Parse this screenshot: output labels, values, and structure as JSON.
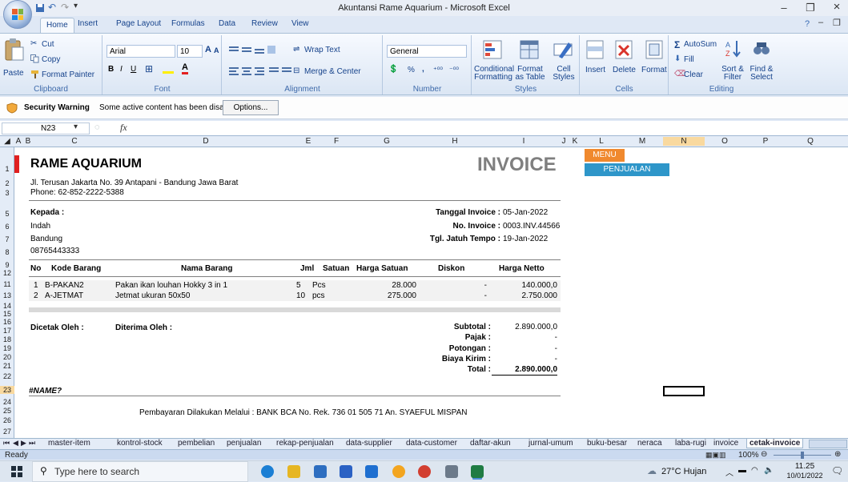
{
  "window": {
    "title": "Akuntansi Rame Aquarium - Microsoft Excel",
    "minimize": "–",
    "maximize": "❐",
    "close": "×"
  },
  "tabs": [
    "Home",
    "Insert",
    "Page Layout",
    "Formulas",
    "Data",
    "Review",
    "View"
  ],
  "ribbon": {
    "clipboard": {
      "paste": "Paste",
      "cut": "Cut",
      "copy": "Copy",
      "format_painter": "Format Painter",
      "label": "Clipboard"
    },
    "font": {
      "name": "Arial",
      "size": "10",
      "label": "Font",
      "bold": "B",
      "italic": "I",
      "underline": "U",
      "grow": "A",
      "shrink": "A"
    },
    "alignment": {
      "wrap": "Wrap Text",
      "merge": "Merge & Center",
      "label": "Alignment"
    },
    "number": {
      "format": "General",
      "percent": "%",
      "comma": ",",
      "label": "Number"
    },
    "styles": {
      "conditional": "Conditional Formatting",
      "format_table": "Format as Table",
      "cell_styles": "Cell Styles",
      "label": "Styles"
    },
    "cells": {
      "insert": "Insert",
      "delete": "Delete",
      "format": "Format",
      "label": "Cells"
    },
    "editing": {
      "autosum": "AutoSum",
      "fill": "Fill",
      "clear": "Clear",
      "sort": "Sort & Filter",
      "find": "Find & Select",
      "label": "Editing"
    }
  },
  "security": {
    "title": "Security Warning",
    "message": "Some active content has been disabled.",
    "button": "Options..."
  },
  "formula_bar": {
    "name_box": "N23",
    "fx": "fx",
    "value": ""
  },
  "columns": [
    "A",
    "B",
    "C",
    "D",
    "E",
    "F",
    "G",
    "H",
    "I",
    "J",
    "K",
    "L",
    "M",
    "N",
    "O",
    "P",
    "Q"
  ],
  "selected_column": "N",
  "rows": [
    "1",
    "2",
    "3",
    "5",
    "6",
    "7",
    "8",
    "9",
    "11",
    "12",
    "13",
    "14",
    "15",
    "16",
    "17",
    "18",
    "19",
    "20",
    "21",
    "22",
    "23",
    "24",
    "25",
    "26",
    "27"
  ],
  "selected_row": "23",
  "invoice": {
    "company": "RAME AQUARIUM",
    "title": "INVOICE",
    "address": "Jl. Terusan Jakarta No. 39 Antapani - Bandung Jawa Barat",
    "phone": "Phone: 62-852-2222-5388",
    "to_label": "Kepada :",
    "customer_name": "Indah",
    "customer_city": "Bandung",
    "customer_phone": "08765443333",
    "date_label": "Tanggal Invoice :",
    "date_value": "05-Jan-2022",
    "number_label": "No. Invoice :",
    "number_value": "0003.INV.44566",
    "due_label": "Tgl. Jatuh Tempo :",
    "due_value": "19-Jan-2022",
    "headers": [
      "No",
      "Kode Barang",
      "Nama Barang",
      "Jml",
      "Satuan",
      "Harga Satuan",
      "Diskon",
      "Harga Netto"
    ],
    "items": [
      [
        "1",
        "B-PAKAN2",
        "Pakan ikan louhan Hokky 3 in 1",
        "5",
        "Pcs",
        "28.000",
        "-",
        "140.000,0"
      ],
      [
        "2",
        "A-JETMAT",
        "Jetmat ukuran 50x50",
        "10",
        "pcs",
        "275.000",
        "-",
        "2.750.000"
      ]
    ],
    "printed_by": "Dicetak Oleh :",
    "received_by": "Diterima Oleh :",
    "subtotal_label": "Subtotal :",
    "subtotal_value": "2.890.000,0",
    "tax_label": "Pajak :",
    "tax_value": "-",
    "discount_label": "Potongan :",
    "discount_value": "-",
    "shipping_label": "Biaya Kirim :",
    "shipping_value": "-",
    "total_label": "Total :",
    "total_value": "2.890.000,0",
    "error": "#NAME?",
    "payment_note": "Pembayaran Dilakukan Melalui : BANK BCA No. Rek. 736 01 505 71 An. SYAEFUL MISPAN"
  },
  "buttons": {
    "menu": "MENU",
    "sales": "PENJUALAN"
  },
  "sheet_tabs": [
    "master-item",
    "kontrol-stock",
    "pembelian",
    "penjualan",
    "rekap-penjualan",
    "data-supplier",
    "data-customer",
    "daftar-akun",
    "jurnal-umum",
    "buku-besar",
    "neraca",
    "laba-rugi",
    "invoice",
    "cetak-invoice"
  ],
  "active_sheet": "cetak-invoice",
  "status": {
    "ready": "Ready",
    "zoom": "100%"
  },
  "taskbar": {
    "search": "Type here to search",
    "weather": "27°C Hujan",
    "time": "11.25",
    "date": "10/01/2022"
  },
  "colors": {
    "menu_button": "#f0892e",
    "sales_button": "#2e96c9",
    "selection": "#f9d99f",
    "invoice_title": "#7f7f7f"
  }
}
